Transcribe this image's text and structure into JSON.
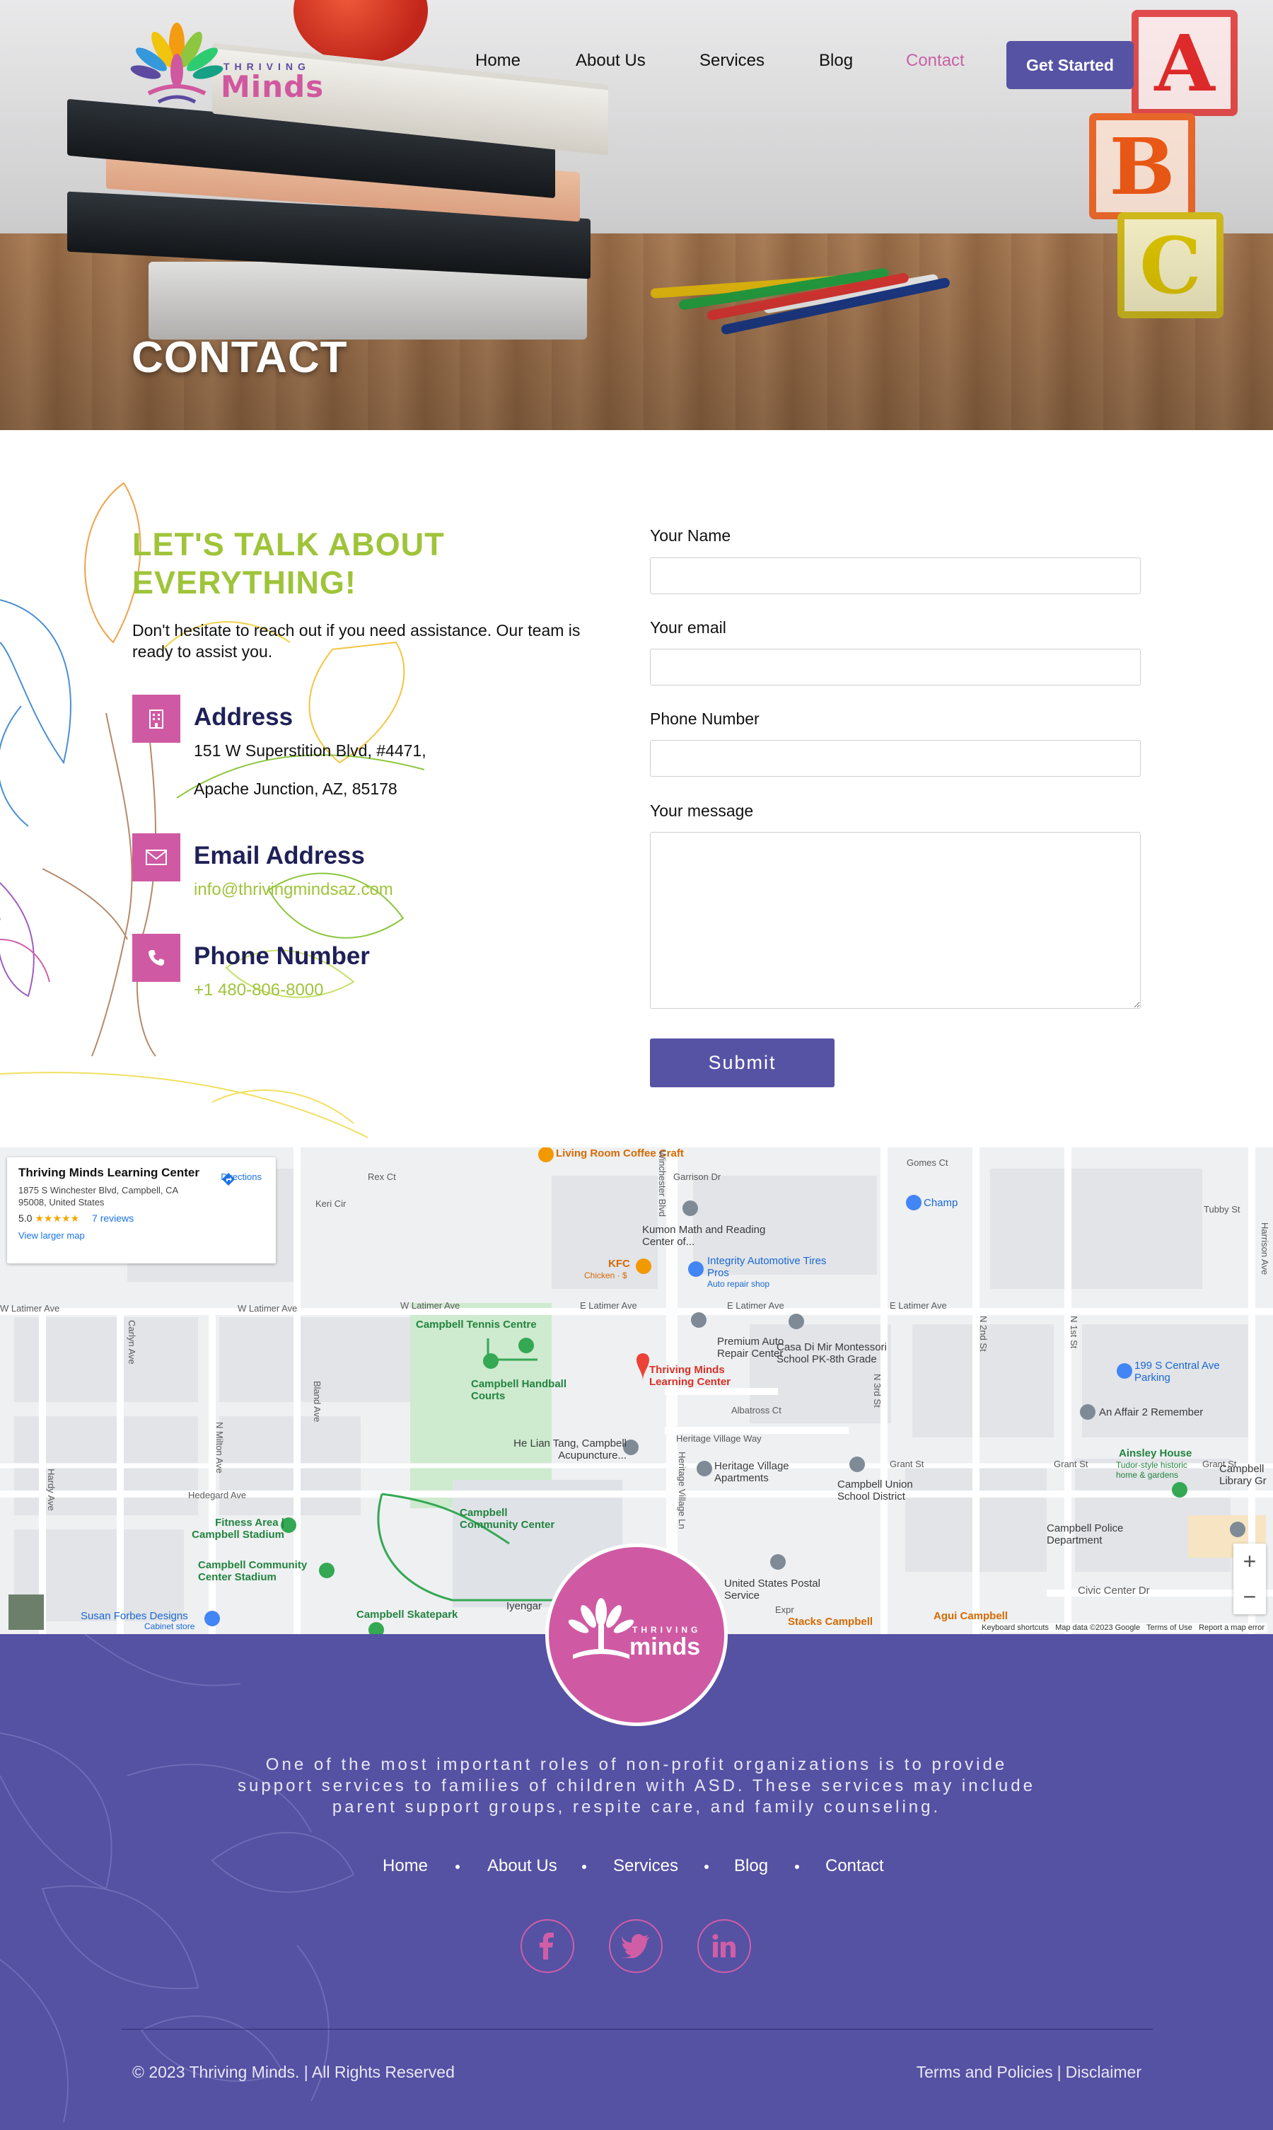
{
  "brand": {
    "logo_top": "THRIVING",
    "logo_main": "Minds"
  },
  "nav": {
    "items": [
      "Home",
      "About Us",
      "Services",
      "Blog",
      "Contact"
    ],
    "active": "Contact",
    "cta": "Get Started"
  },
  "hero": {
    "title": "CONTACT",
    "blocks": [
      "A",
      "B",
      "C"
    ]
  },
  "contact": {
    "heading": "LET'S TALK ABOUT EVERYTHING!",
    "subtext": "Don't hesitate to reach out if you need assistance. Our team is ready to assist you.",
    "address": {
      "title": "Address",
      "line1": "151 W Superstition Blvd, #4471,",
      "line2": "Apache Junction, AZ, 85178",
      "icon": "building-icon"
    },
    "email": {
      "title": "Email Address",
      "value": "info@thrivingmindsaz.com",
      "icon": "envelope-icon"
    },
    "phone": {
      "title": "Phone Number",
      "value": "+1 480-806-8000",
      "icon": "phone-icon"
    }
  },
  "form": {
    "name_label": "Your Name",
    "email_label": "Your email",
    "phone_label": "Phone Number",
    "message_label": "Your message",
    "submit": "Submit"
  },
  "map": {
    "card": {
      "title": "Thriving Minds Learning Center",
      "address": "1875 S Winchester Blvd, Campbell, CA 95008, United States",
      "rating": "5.0",
      "stars": "★★★★★",
      "reviews": "7 reviews",
      "larger_map": "View larger map",
      "directions": "Directions"
    },
    "places": {
      "living_room": "Living Room Coffee Craft",
      "kumon": "Kumon Math and Reading Center of...",
      "kfc": "KFC",
      "kfc_sub": "Chicken · $",
      "integrity": "Integrity Automotive Tires Pros",
      "integrity_sub": "Auto repair shop",
      "tennis": "Campbell Tennis Centre",
      "handball": "Campbell Handball Courts",
      "thriving": "Thriving Minds Learning Center",
      "premium": "Premium Auto Repair Center",
      "casa": "Casa Di Mir Montessori School PK-8th Grade",
      "champ": "Champ",
      "parking": "199 S Central Ave Parking",
      "affair": "An Affair 2 Remember",
      "helian": "He Lian Tang, Campbell Acupuncture...",
      "heritage": "Heritage Village Apartments",
      "union": "Campbell Union School District",
      "ainsley": "Ainsley House",
      "ainsley_sub": "Tudor-style historic home & gardens",
      "police": "Campbell Police Department",
      "library": "Campbell Library Gr",
      "fitness": "Fitness Area | Campbell Stadium",
      "community": "Campbell Community Center",
      "community_stadium": "Campbell Community Center Stadium",
      "usps": "United States Postal Service",
      "susan": "Susan Forbes Designs",
      "susan_sub": "Cabinet store",
      "skatepark": "Campbell Skatepark",
      "stacks": "Stacks Campbell",
      "agui": "Agui Campbell",
      "iyengar": "Iyengar"
    },
    "streets": {
      "latimer_w": "W Latimer Ave",
      "latimer_w2": "W Latimer Ave",
      "latimer_w3": "W Latimer Ave",
      "latimer_e": "E Latimer Ave",
      "latimer_e2": "E Latimer Ave",
      "latimer_e3": "E Latimer Ave",
      "hedegard": "Hedegard Ave",
      "albatross": "Albatross Ct",
      "heritage_way": "Heritage Village Way",
      "grant": "Grant St",
      "grant2": "Grant St",
      "grant3": "Grant St",
      "civic": "Civic Center Dr",
      "gomes": "Gomes Ct",
      "garrison": "Garrison Dr",
      "tubby": "Tubby St",
      "rex": "Rex Ct",
      "keri": "Keri Cir",
      "hardy": "Hardy Ave",
      "carlyn": "Carlyn Ave",
      "bland": "Bland Ave",
      "milton": "N Milton Ave",
      "n2nd": "N 2nd St",
      "n3rd": "N 3rd St",
      "n1st": "N 1st St",
      "harrison": "Harrison Ave",
      "winchester": "Winchester Blvd",
      "heritage_ln": "Heritage Village Ln",
      "expr": "Expr"
    },
    "footer": [
      "Keyboard shortcuts",
      "Map data ©2023 Google",
      "Terms of Use",
      "Report a map error"
    ],
    "zoom_in": "+",
    "zoom_out": "−"
  },
  "footer": {
    "logo_top": "THRIVING",
    "logo_main": "minds",
    "text": "One of the most important roles of non-profit organizations is to provide support services to families of children with ASD. These services may include parent support groups, respite care, and family counseling.",
    "nav": [
      "Home",
      "About Us",
      "Services",
      "Blog",
      "Contact"
    ],
    "social": [
      "facebook-icon",
      "twitter-icon",
      "linkedin-icon"
    ],
    "copyright": "© 2023 Thriving Minds. | All Rights Reserved",
    "legal": [
      "Terms and Policies",
      "|",
      "Disclaimer"
    ]
  },
  "colors": {
    "primary": "#5653a5",
    "accent": "#cf5aa3",
    "green": "#9fc43a",
    "navy": "#1f2057"
  }
}
